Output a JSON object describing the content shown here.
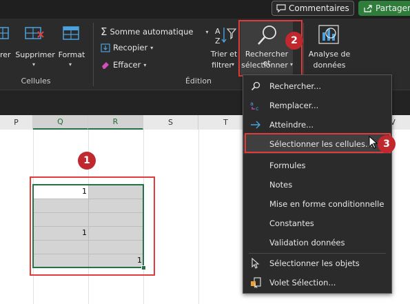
{
  "topbar": {
    "comments_label": "Commentaires",
    "share_label": "Partager"
  },
  "ribbon": {
    "cells_group": {
      "partial_label": "rer",
      "delete_label": "Supprimer",
      "format_label": "Format",
      "group_label": "Cellules"
    },
    "editing_group": {
      "autosum_label": "Somme automatique",
      "fill_label": "Recopier",
      "clear_label": "Effacer",
      "sort_label_1": "Trier et",
      "sort_label_2": "filtrer",
      "find_label_1": "Rechercher et",
      "find_label_2": "sélectionner",
      "group_label": "Édition"
    },
    "analysis_group": {
      "label_1": "Analyse de",
      "label_2": "données"
    }
  },
  "columns": [
    "P",
    "Q",
    "R",
    "S",
    "T",
    "V"
  ],
  "cells": {
    "q_row1": "1",
    "q_row4": "1",
    "r_row5": "1"
  },
  "menu": {
    "items": [
      {
        "label": "Rechercher...",
        "icon": "search-icon"
      },
      {
        "label": "Remplacer...",
        "icon": "replace-icon"
      },
      {
        "label": "Atteindre...",
        "icon": "arrow-right-icon"
      },
      {
        "label": "Sélectionner les cellules...",
        "icon": ""
      },
      {
        "label": "Formules",
        "icon": ""
      },
      {
        "label": "Notes",
        "icon": ""
      },
      {
        "label": "Mise en forme conditionnelle",
        "icon": ""
      },
      {
        "label": "Constantes",
        "icon": ""
      },
      {
        "label": "Validation données",
        "icon": ""
      },
      {
        "label": "Sélectionner les objets",
        "icon": "cursor-icon"
      },
      {
        "label": "Volet Sélection...",
        "icon": "selection-pane-icon"
      }
    ]
  },
  "annotations": {
    "badge_1": "1",
    "badge_2": "2",
    "badge_3": "3"
  },
  "colors": {
    "annotation_red": "#e03a3a",
    "selection_green": "#217346",
    "selected_fill": "#d4d4d4",
    "ribbon_bg": "#2b2b2b"
  }
}
